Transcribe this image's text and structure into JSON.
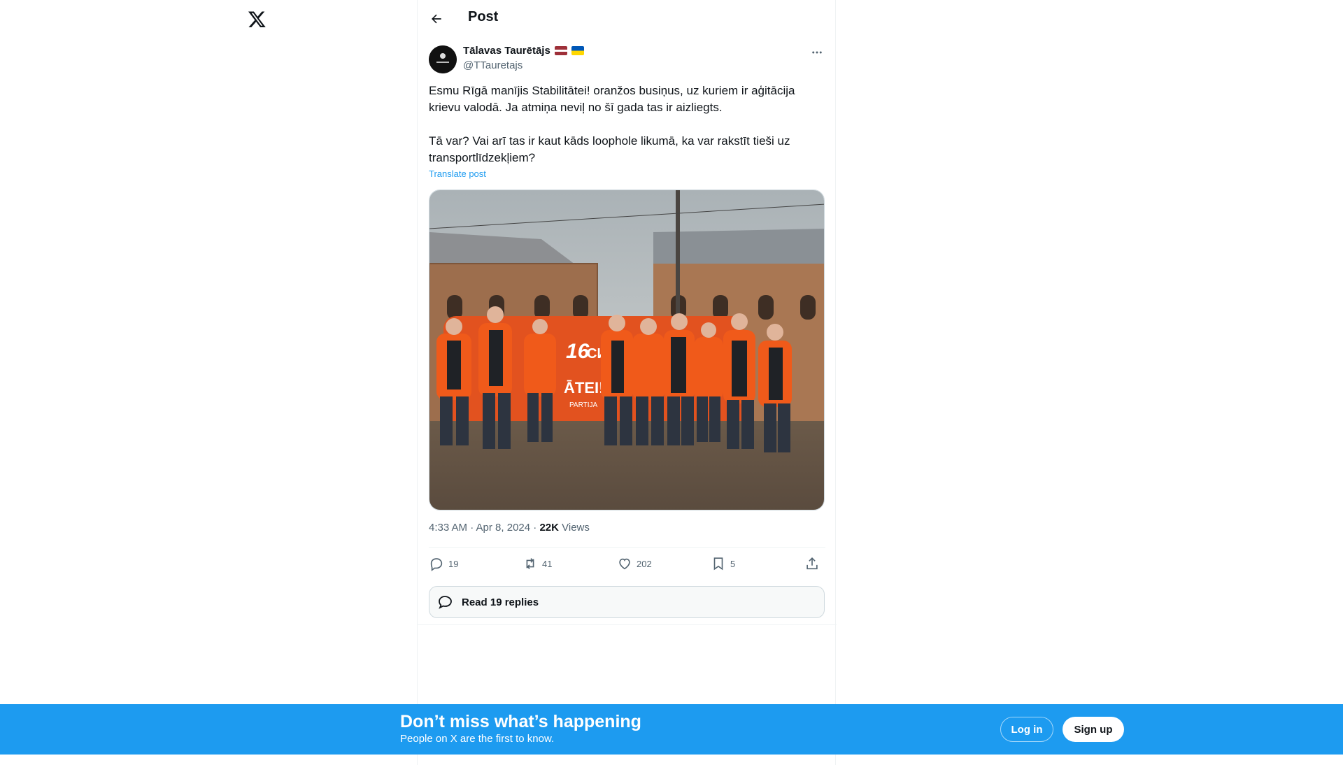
{
  "header": {
    "title": "Post"
  },
  "post": {
    "author_name": "Tālavas Taurētājs",
    "author_handle": "@TTauretajs",
    "text": "Esmu Rīgā manījis Stabilitātei! oranžos busiņus, uz kuriem ir aģitācija krievu valodā. Ja atmiņa neviļ no šī gada tas ir aizliegts.\n\nTā var? Vai arī tas ir kaut kāds loophole likumā, ka var rakstīt tieši uz transportlīdzekļiem?",
    "translate_label": "Translate post",
    "timestamp": "4:33 AM · Apr 8, 2024 · ",
    "views_count": "22K",
    "views_label": " Views",
    "photo_text": {
      "number": "16",
      "cyrillic": "СИ",
      "brand": "ĀTEI!",
      "brand_sub": "PARTIJA"
    }
  },
  "actions": {
    "replies": "19",
    "reposts": "41",
    "likes": "202",
    "bookmarks": "5"
  },
  "read_replies_label": "Read 19 replies",
  "bottom_bar": {
    "title": "Don’t miss what’s happening",
    "subtitle": "People on X are the first to know.",
    "login_label": "Log in",
    "signup_label": "Sign up"
  },
  "colors": {
    "accent": "#1d9bf0",
    "text": "#0f1419",
    "secondary": "#536471"
  }
}
